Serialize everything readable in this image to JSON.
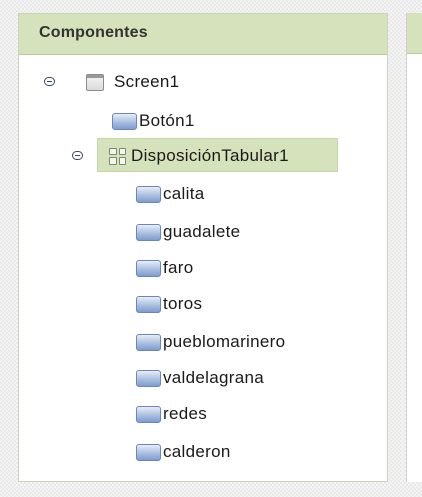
{
  "panel": {
    "title": "Componentes"
  },
  "tree": {
    "screen": {
      "label": "Screen1",
      "icon": "screen-icon",
      "expanded": true
    },
    "button": {
      "label": "Botón1",
      "icon": "button-icon"
    },
    "table": {
      "label": "DisposiciónTabular1",
      "icon": "table-arrangement-icon",
      "expanded": true,
      "selected": true
    },
    "children": [
      {
        "label": "calita",
        "icon": "button-icon"
      },
      {
        "label": "guadalete",
        "icon": "button-icon"
      },
      {
        "label": "faro",
        "icon": "button-icon"
      },
      {
        "label": "toros",
        "icon": "button-icon"
      },
      {
        "label": "pueblomarinero",
        "icon": "button-icon"
      },
      {
        "label": "valdelagrana",
        "icon": "button-icon"
      },
      {
        "label": "redes",
        "icon": "button-icon"
      },
      {
        "label": "calderon",
        "icon": "button-icon"
      }
    ]
  },
  "colors": {
    "header_bg": "#d5e2bb",
    "selection_bg": "#d5e2bb",
    "button_icon": "#8fa9d8"
  }
}
